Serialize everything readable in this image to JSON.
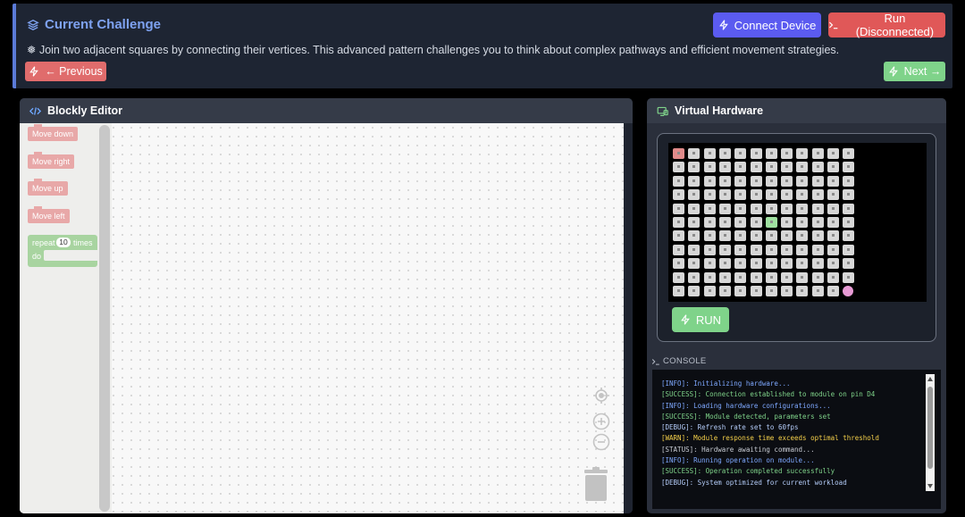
{
  "challenge": {
    "title": "Current Challenge",
    "description": "❅ Join two adjacent squares by connecting their vertices. This advanced pattern challenges you to think about complex pathways and efficient movement strategies.",
    "connect_label": "Connect Device",
    "run_label": "Run (Disconnected)",
    "prev_label": "← Previous",
    "next_label": "Next →"
  },
  "editor": {
    "title": "Blockly Editor",
    "blocks": [
      "Move down",
      "Move right",
      "Move up",
      "Move left"
    ],
    "repeat": {
      "label": "repeat",
      "count": "10",
      "times": "times",
      "do": "do"
    }
  },
  "hardware": {
    "title": "Virtual Hardware",
    "run_label": "RUN",
    "grid": {
      "cols": 12,
      "rows": 11,
      "start": [
        0,
        0
      ],
      "goal": [
        6,
        5
      ],
      "cursor": [
        11,
        10
      ]
    }
  },
  "console": {
    "label": "CONSOLE",
    "lines": [
      {
        "text": "[INFO]: Initializing hardware...",
        "level": "info"
      },
      {
        "text": "[SUCCESS]: Connection established to module on pin D4",
        "level": "success"
      },
      {
        "text": "[INFO]: Loading hardware configurations...",
        "level": "info"
      },
      {
        "text": "[SUCCESS]: Module detected, parameters set",
        "level": "success"
      },
      {
        "text": "[DEBUG]: Refresh rate set to 60fps",
        "level": "debug"
      },
      {
        "text": "[WARN]: Module response time exceeds optimal threshold",
        "level": "warn"
      },
      {
        "text": "[STATUS]: Hardware awaiting command...",
        "level": "status"
      },
      {
        "text": "[INFO]: Running operation on module...",
        "level": "info"
      },
      {
        "text": "[SUCCESS]: Operation completed successfully",
        "level": "success"
      },
      {
        "text": "[DEBUG]: System optimized for current workload",
        "level": "debug"
      }
    ]
  }
}
